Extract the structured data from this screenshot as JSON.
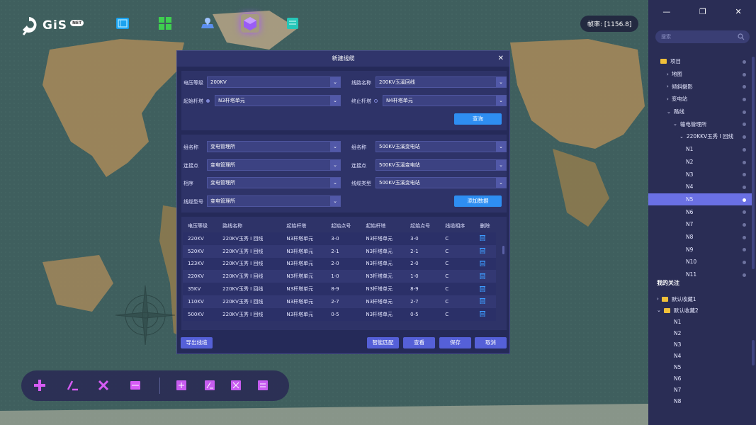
{
  "app": {
    "logo_text": "GiS",
    "logo_badge": "NET",
    "fps_label": "帧率: [1156.8]"
  },
  "top_tools": [
    {
      "name": "layers-tool",
      "color": "#2aa7f0"
    },
    {
      "name": "grid-tool",
      "color": "#3ecf4f"
    },
    {
      "name": "map-pin-tool",
      "color": "#6fa6ff"
    },
    {
      "name": "cube-tool",
      "color": "#9a5cf6"
    },
    {
      "name": "document-tool",
      "color": "#26c6b8"
    }
  ],
  "panel": {
    "search_placeholder": "搜索",
    "tree": [
      {
        "label": "项目",
        "level": 0,
        "icon": "folder",
        "arrow": ""
      },
      {
        "label": "地图",
        "level": 1,
        "arrow": "›"
      },
      {
        "label": "倾斜摄影",
        "level": 1,
        "arrow": "›"
      },
      {
        "label": "变电站",
        "level": 1,
        "arrow": "›"
      },
      {
        "label": "路线",
        "level": 1,
        "arrow": "⌄"
      },
      {
        "label": "输电管理所",
        "level": 2,
        "arrow": "⌄"
      },
      {
        "label": "220KKV玉秀 I 回线",
        "level": 3,
        "arrow": "⌄"
      },
      {
        "label": "N1",
        "level": 4,
        "arrow": ""
      },
      {
        "label": "N2",
        "level": 4,
        "arrow": ""
      },
      {
        "label": "N3",
        "level": 4,
        "arrow": ""
      },
      {
        "label": "N4",
        "level": 4,
        "arrow": ""
      },
      {
        "label": "N5",
        "level": 4,
        "arrow": "",
        "selected": true
      },
      {
        "label": "N6",
        "level": 4,
        "arrow": ""
      },
      {
        "label": "N7",
        "level": 4,
        "arrow": ""
      },
      {
        "label": "N8",
        "level": 4,
        "arrow": ""
      },
      {
        "label": "N9",
        "level": 4,
        "arrow": ""
      },
      {
        "label": "N10",
        "level": 4,
        "arrow": ""
      },
      {
        "label": "N11",
        "level": 4,
        "arrow": ""
      }
    ],
    "fav_title": "我的关注",
    "favorites": [
      {
        "label": "默认收藏1",
        "arrow": "›",
        "folder": true
      },
      {
        "label": "默认收藏2",
        "arrow": "⌄",
        "folder": true
      },
      {
        "label": "N1"
      },
      {
        "label": "N2"
      },
      {
        "label": "N3"
      },
      {
        "label": "N4"
      },
      {
        "label": "N5"
      },
      {
        "label": "N6"
      },
      {
        "label": "N7"
      },
      {
        "label": "N8"
      }
    ]
  },
  "dialog": {
    "title": "新建线缆",
    "form1": {
      "voltage_label": "电压等级",
      "voltage_value": "200KV",
      "line_label": "线路名称",
      "line_value": "200KV玉溪回线",
      "start_label": "起始杆塔",
      "start_value": "N3杆塔单元",
      "end_label": "终止杆塔",
      "end_value": "N4杆塔单元",
      "query_button": "查询"
    },
    "form2": {
      "group_label_l": "组名称",
      "group_value_l": "变电管理所",
      "group_label_r": "组名称",
      "group_value_r": "500KV玉溪变电站",
      "conn_label_l": "连接点",
      "conn_value_l": "变电管理所",
      "conn_label_r": "连接点",
      "conn_value_r": "500KV玉溪变电站",
      "phase_label": "相序",
      "phase_value": "变电管理所",
      "cable_type_label": "线缆类型",
      "cable_type_value": "500KV玉溪变电站",
      "cable_model_label": "线缆型号",
      "cable_model_value": "变电管理所",
      "add_button": "添加数据"
    },
    "table": {
      "headers": [
        "电压等级",
        "路线名称",
        "起始杆塔",
        "起始点号",
        "起始杆塔",
        "起始点号",
        "线缆相序",
        "删除"
      ],
      "rows": [
        [
          "220KV",
          "220KV玉秀 I 回线",
          "N3杆塔单元",
          "3-0",
          "N3杆塔单元",
          "3-0",
          "C"
        ],
        [
          "520KV",
          "220KV玉秀 I 回线",
          "N3杆塔单元",
          "2-1",
          "N3杆塔单元",
          "2-1",
          "C"
        ],
        [
          "123KV",
          "220KV玉秀 I 回线",
          "N3杆塔单元",
          "2-0",
          "N3杆塔单元",
          "2-0",
          "C"
        ],
        [
          "220KV",
          "220KV玉秀 I 回线",
          "N3杆塔单元",
          "1-0",
          "N3杆塔单元",
          "1-0",
          "C"
        ],
        [
          "35KV",
          "220KV玉秀 I 回线",
          "N3杆塔单元",
          "8-9",
          "N3杆塔单元",
          "8-9",
          "C"
        ],
        [
          "110KV",
          "220KV玉秀 I 回线",
          "N3杆塔单元",
          "2-7",
          "N3杆塔单元",
          "2-7",
          "C"
        ],
        [
          "500KV",
          "220KV玉秀 I 回线",
          "N3杆塔单元",
          "0-5",
          "N3杆塔单元",
          "0-5",
          "C"
        ]
      ]
    },
    "footer": {
      "export": "导出线缆",
      "match": "智能匹配",
      "view": "查看",
      "save": "保存",
      "cancel": "取消"
    }
  },
  "draw_tools": [
    "add-icon",
    "draw-line-icon",
    "delete-icon",
    "list-icon",
    "add-small-icon",
    "edit-small-icon",
    "remove-small-icon",
    "menu-small-icon"
  ],
  "colors": {
    "accent": "#2e8ef2",
    "panel": "#2a2d55",
    "dialog": "#252a59",
    "selected": "#6a70e4",
    "magenta": "#c75cf0"
  }
}
